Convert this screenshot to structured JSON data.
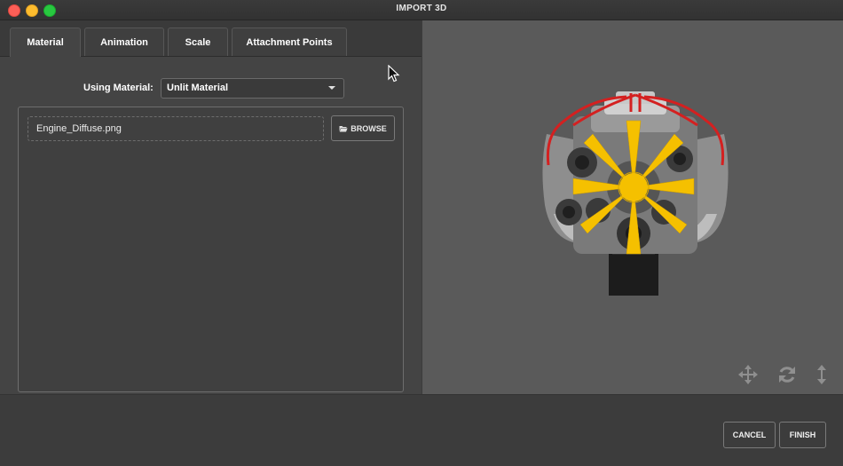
{
  "window": {
    "title": "IMPORT 3D"
  },
  "tabs": [
    {
      "label": "Material",
      "active": true
    },
    {
      "label": "Animation",
      "active": false
    },
    {
      "label": "Scale",
      "active": false
    },
    {
      "label": "Attachment Points",
      "active": false
    }
  ],
  "material": {
    "label": "Using Material:",
    "selected": "Unlit Material",
    "texture_file": "Engine_Diffuse.png",
    "browse_label": "BROWSE",
    "browse_icon": "folder-open-icon"
  },
  "viewport": {
    "model": "engine-3d-model",
    "tools": [
      "move-icon",
      "rotate-icon",
      "vertical-resize-icon"
    ]
  },
  "footer": {
    "cancel_label": "CANCEL",
    "finish_label": "FINISH"
  },
  "colors": {
    "background": "#3c3c3c",
    "panel": "#444444",
    "viewport": "#5a5a5a",
    "accent_yellow": "#f5c000",
    "wire_red": "#d42020"
  }
}
